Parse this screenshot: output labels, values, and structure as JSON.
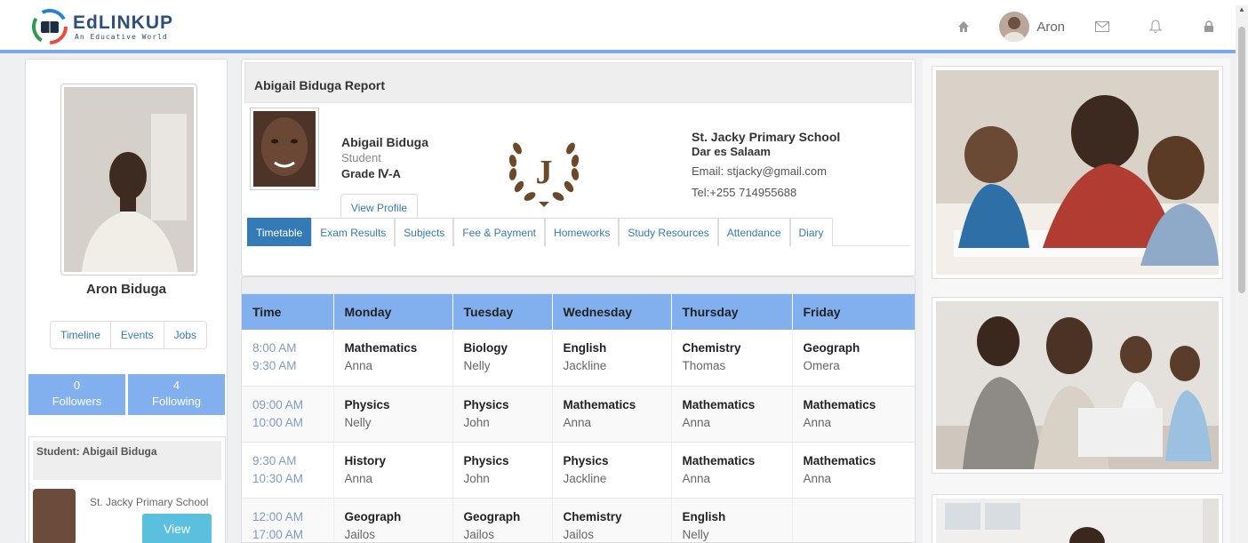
{
  "app": {
    "logo_text": "EdLINKUP",
    "logo_tagline": "An Educative World",
    "user_name": "Aron",
    "icons": [
      "home-icon",
      "mail-icon",
      "bell-icon",
      "lock-icon"
    ]
  },
  "sidebar": {
    "profile_name": "Aron Biduga",
    "pills": [
      "Timeline",
      "Events",
      "Jobs"
    ],
    "followers": {
      "count": "0",
      "label": "Followers"
    },
    "following": {
      "count": "4",
      "label": "Following"
    },
    "student_label": "Student:",
    "student_name": "Abigail Biduga",
    "student_school": "St. Jacky Primary School",
    "view_label": "View"
  },
  "report": {
    "title": "Abigail Biduga Report",
    "child_name": "Abigail Biduga",
    "child_role": "Student",
    "child_grade": "Grade Ⅳ-A",
    "view_profile": "View Profile",
    "crest_letter": "J",
    "school_name": "St. Jacky Primary School",
    "school_city": "Dar es Salaam",
    "school_email": "Email: stjacky@gmail.com",
    "school_tel": "Tel:+255 714955688",
    "tabs": [
      "Timetable",
      "Exam Results",
      "Subjects",
      "Fee & Payment",
      "Homeworks",
      "Study Resources",
      "Attendance",
      "Diary"
    ],
    "active_tab": "Timetable"
  },
  "timetable": {
    "headers": [
      "Time",
      "Monday",
      "Tuesday",
      "Wednesday",
      "Thursday",
      "Friday"
    ],
    "rows": [
      {
        "start": "8:00 AM",
        "end": "9:30 AM",
        "cells": [
          [
            "Mathematics",
            "Anna"
          ],
          [
            "Biology",
            "Nelly"
          ],
          [
            "English",
            "Jackline"
          ],
          [
            "Chemistry",
            "Thomas"
          ],
          [
            "Geograph",
            "Omera"
          ]
        ]
      },
      {
        "start": "09:00 AM",
        "end": "10:00 AM",
        "cells": [
          [
            "Physics",
            "Nelly"
          ],
          [
            "Physics",
            "John"
          ],
          [
            "Mathematics",
            "Anna"
          ],
          [
            "Mathematics",
            "Anna"
          ],
          [
            "Mathematics",
            "Anna"
          ]
        ]
      },
      {
        "start": "9:30 AM",
        "end": "10:30 AM",
        "cells": [
          [
            "History",
            "Anna"
          ],
          [
            "Physics",
            "John"
          ],
          [
            "Physics",
            "Jackline"
          ],
          [
            "Mathematics",
            "Anna"
          ],
          [
            "Mathematics",
            "Anna"
          ]
        ]
      },
      {
        "start": "12:00 AM",
        "end": "17:00 AM",
        "cells": [
          [
            "Geograph",
            "Jailos"
          ],
          [
            "Geograph",
            "Jailos"
          ],
          [
            "Chemistry",
            "Jailos"
          ],
          [
            "English",
            "Nelly"
          ],
          [
            "",
            ""
          ]
        ]
      }
    ]
  },
  "colors": {
    "accent": "#337ab7",
    "header_blue": "#82b0ef",
    "follow_blue": "#82b0ef",
    "view_btn": "#5bc0de",
    "time_text": "#7f9cc4"
  }
}
